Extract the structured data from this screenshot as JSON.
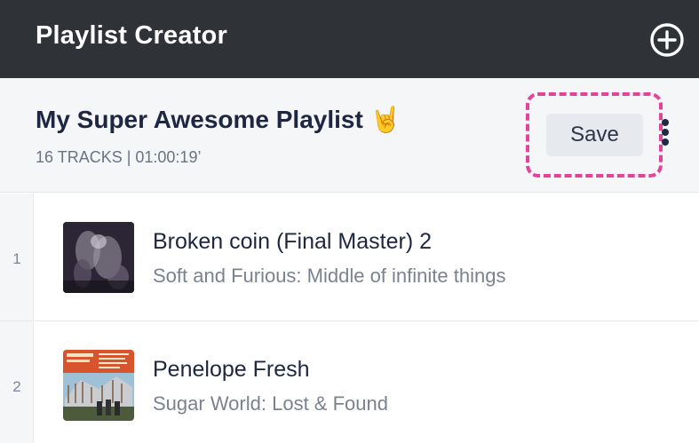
{
  "app": {
    "title": "Playlist Creator",
    "add_icon": "plus-circle-icon"
  },
  "playlist": {
    "title": "My Super Awesome Playlist",
    "emoji": "🤘",
    "meta": "16 TRACKS | 01:00:19’",
    "save_label": "Save",
    "more_icon": "vertical-dots-icon"
  },
  "colors": {
    "topbar_bg": "#2f3338",
    "header_bg": "#f4f6f8",
    "highlight": "#e5439a",
    "text_primary": "#1d2742",
    "text_secondary": "#7a8290"
  },
  "tracks": [
    {
      "number": "1",
      "title": "Broken coin (Final Master) 2",
      "subtitle": "Soft and Furious: Middle of infinite things"
    },
    {
      "number": "2",
      "title": "Penelope Fresh",
      "subtitle": "Sugar World: Lost & Found"
    }
  ]
}
